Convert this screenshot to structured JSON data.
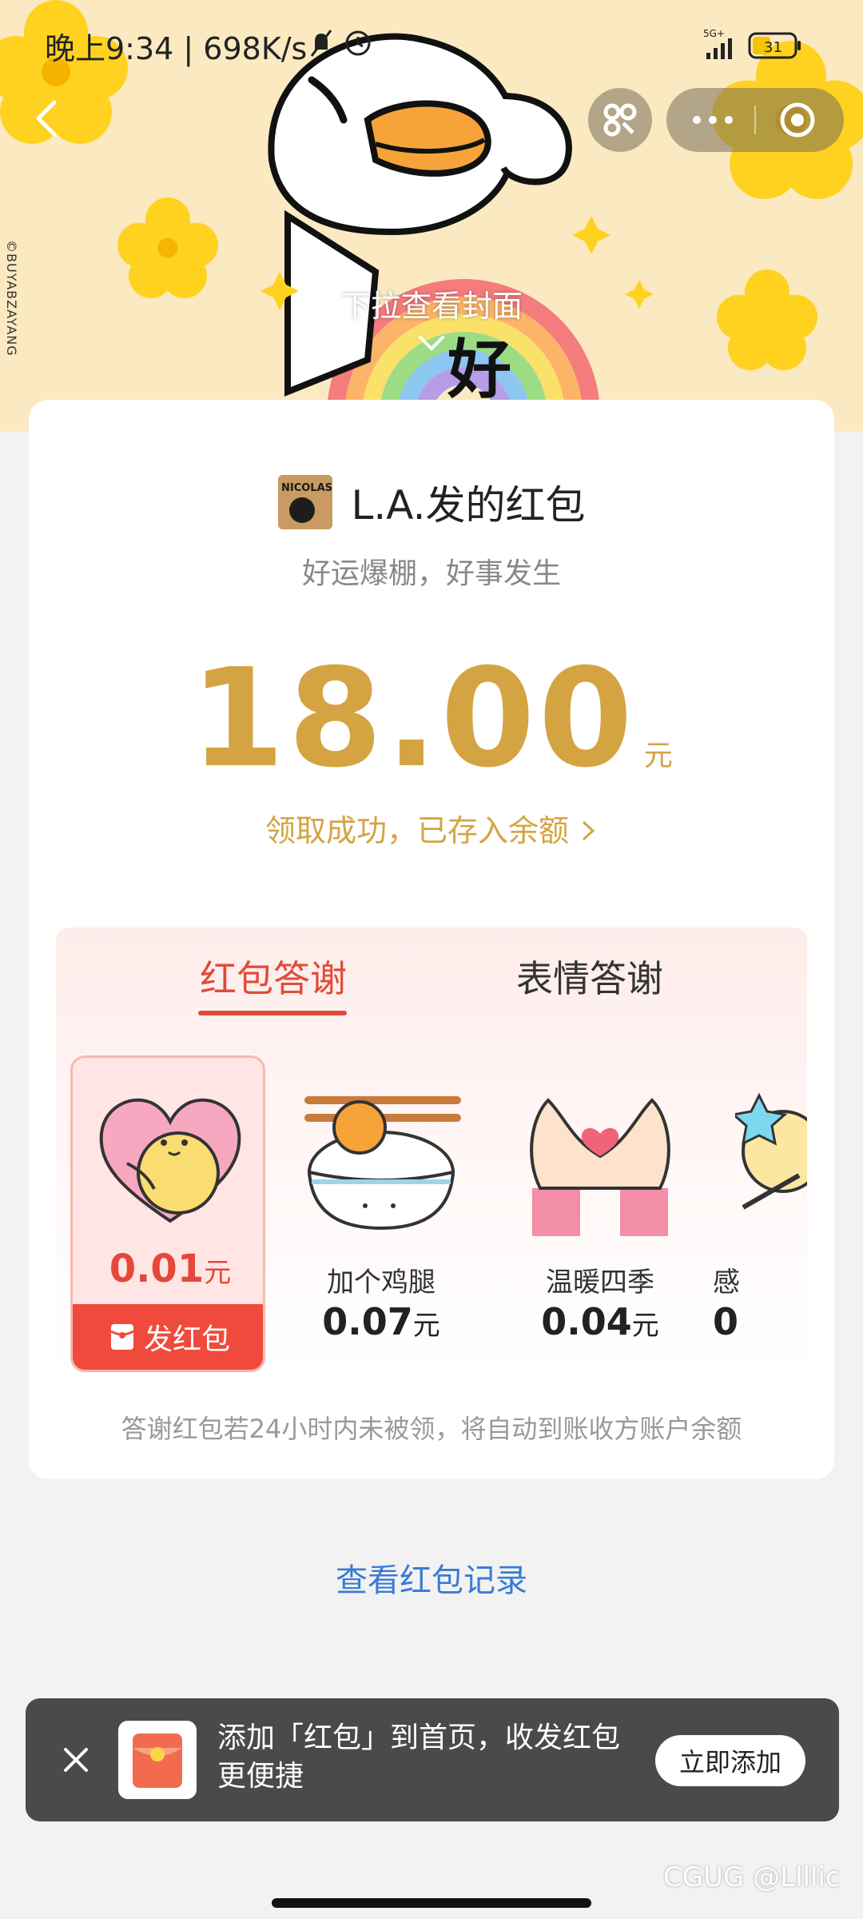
{
  "status_bar": {
    "time": "晚上9:34 | 698K/s",
    "network": "5G+",
    "battery": "31"
  },
  "cover": {
    "credit": "©BUYABZAYANG",
    "pull_hint": "下拉查看封面",
    "sticker_char": "好"
  },
  "sender": {
    "avatar_text": "NICOLAS KIN",
    "title": "L.A.发的红包",
    "blessing": "好运爆棚，好事发生"
  },
  "amount": {
    "value": "18.00",
    "unit": "元",
    "status_link": "领取成功，已存入余额"
  },
  "thanks": {
    "tabs": [
      "红包答谢",
      "表情答谢"
    ],
    "active_tab": 0,
    "selected_gift": {
      "price": "0.01",
      "unit": "元",
      "send_label": "发红包"
    },
    "gifts": [
      {
        "name": "加个鸡腿",
        "price": "0.07",
        "unit": "元"
      },
      {
        "name": "温暖四季",
        "price": "0.04",
        "unit": "元"
      },
      {
        "name": "感",
        "price": "0",
        "unit": ""
      }
    ],
    "footnote": "答谢红包若24小时内未被领，将自动到账收方账户余额"
  },
  "records_link": "查看红包记录",
  "banner": {
    "text": "添加「红包」到首页，收发红包更便捷",
    "add_button": "立即添加"
  },
  "watermark": "CGUG @Llllic",
  "colors": {
    "accent_gold": "#d4a443",
    "accent_red": "#e04b3a",
    "link_blue": "#3a7bd5"
  }
}
